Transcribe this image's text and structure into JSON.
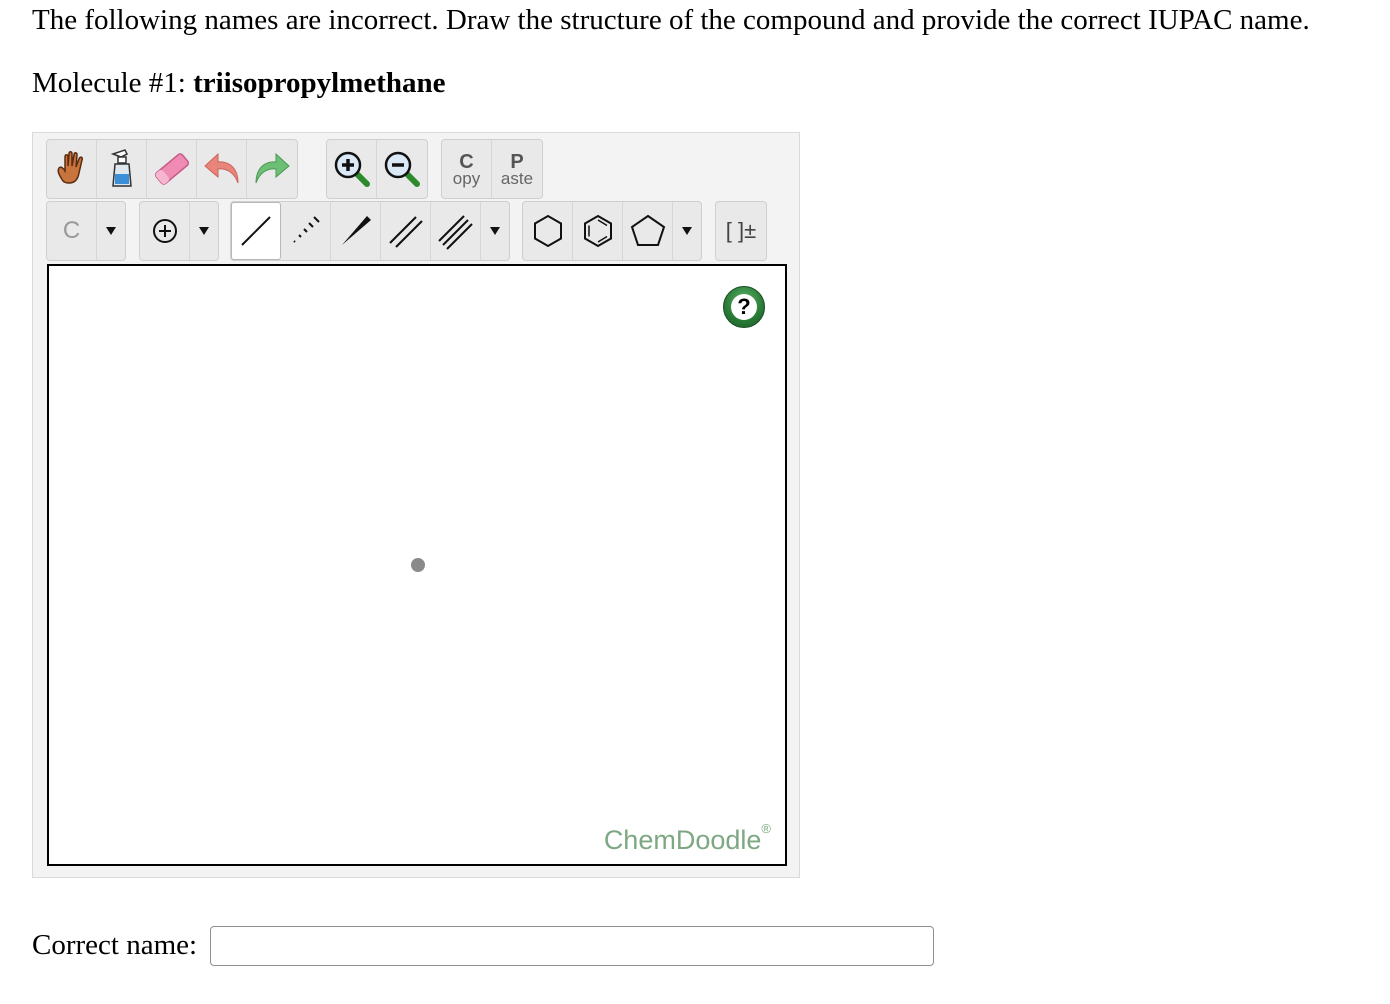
{
  "question": {
    "instructions": "The following names are incorrect. Draw the structure of the compound and provide the correct IUPAC name.",
    "molecule_prefix": "Molecule #1: ",
    "molecule_name": "triisopropylmethane"
  },
  "toolbar": {
    "row1": {
      "hand_icon": "hand-icon",
      "clear_icon": "spray-bottle-icon",
      "eraser_icon": "eraser-icon",
      "undo_icon": "undo-icon",
      "redo_icon": "redo-icon",
      "zoom_in_icon": "zoom-in-icon",
      "zoom_out_icon": "zoom-out-icon",
      "copy_big": "C",
      "copy_small": "opy",
      "paste_big": "P",
      "paste_small": "aste"
    },
    "row2": {
      "element_label": "C",
      "charge_symbol": "⊕",
      "bracket_label": "[ ]±"
    }
  },
  "canvas": {
    "help_label": "?",
    "brand": "ChemDoodle",
    "brand_mark": "®"
  },
  "answer": {
    "label": "Correct name:",
    "value": "",
    "placeholder": ""
  },
  "colors": {
    "brand_green": "#7ea883",
    "help_green": "#2b7d38",
    "eraser_pink": "#f08cb3",
    "undo_red": "#e8847a",
    "redo_green": "#6cbf74"
  }
}
